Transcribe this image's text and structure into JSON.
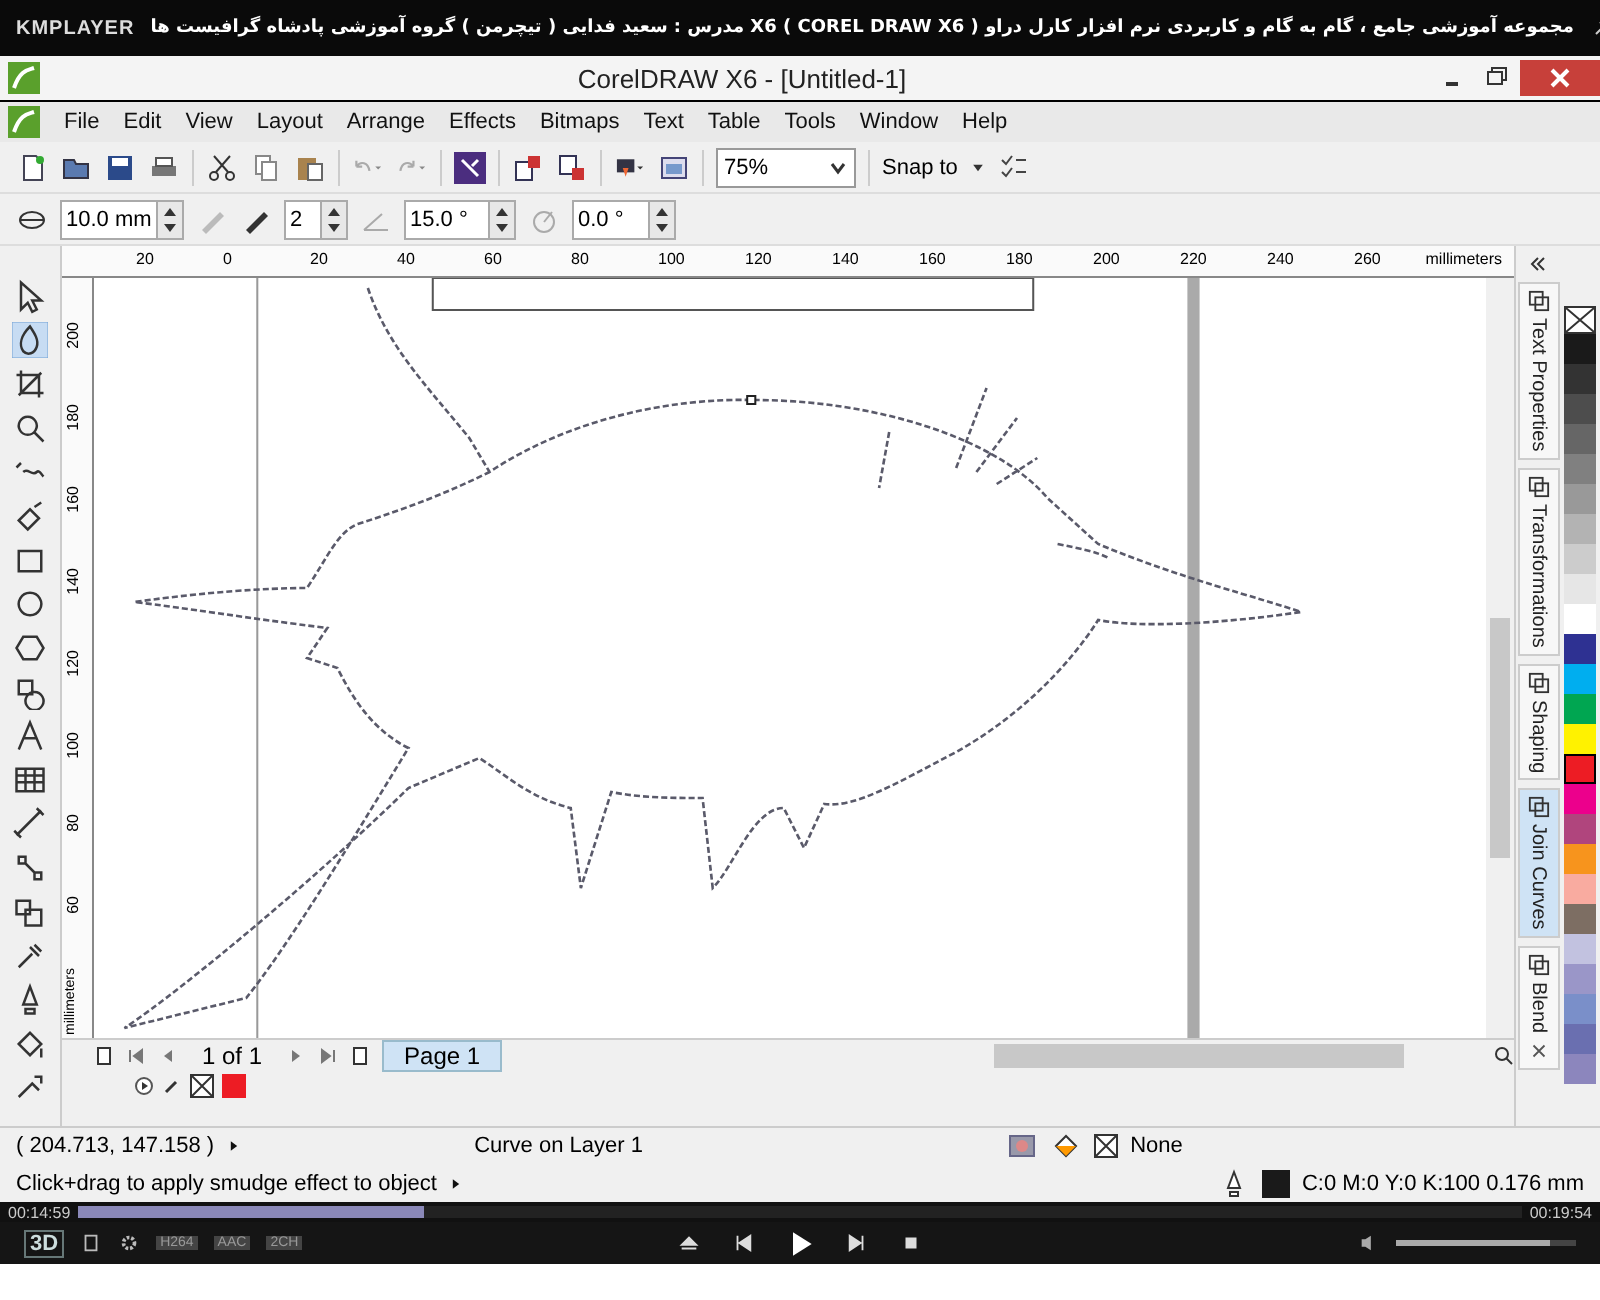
{
  "player": {
    "logo": "KMPLAYER",
    "title": "مجموعه آموزشی جامع ، گام به گام و کاربردی نرم افزار کارل دراو X6 ( COREL DRAW X6 )   مدرس : سعید فدایی ( تیچرمن ) گروه آموزشی پادشاه گرافیست ها",
    "elapsed": "00:14:59",
    "total": "00:19:54",
    "level": 0.24,
    "badges": [
      "3D",
      "H264",
      "AAC",
      "2CH"
    ],
    "volume": {
      "level": 0.86
    }
  },
  "window": {
    "title": "CorelDRAW X6 - [Untitled-1]"
  },
  "menu": [
    "File",
    "Edit",
    "View",
    "Layout",
    "Arrange",
    "Effects",
    "Bitmaps",
    "Text",
    "Table",
    "Tools",
    "Window",
    "Help"
  ],
  "toolbar": {
    "zoom": "75%",
    "snap": "Snap to"
  },
  "property_bar": {
    "fields": [
      "10.0 mm",
      "2",
      "15.0 °",
      "0.0 °"
    ]
  },
  "rulers": {
    "horizontal": [
      "20",
      "0",
      "20",
      "40",
      "60",
      "80",
      "100",
      "120",
      "140",
      "160",
      "180",
      "200",
      "220",
      "240",
      "260"
    ],
    "horizontal_unit": "millimeters",
    "vertical": [
      "200",
      "180",
      "160",
      "140",
      "120",
      "100",
      "80",
      "60"
    ],
    "vertical_unit": "millimeters"
  },
  "tools": [
    {
      "kind": "pick",
      "selected": false
    },
    {
      "kind": "smudge",
      "selected": true
    },
    {
      "kind": "crop",
      "selected": false
    },
    {
      "kind": "zoom",
      "selected": false
    },
    {
      "kind": "freehand",
      "selected": false
    },
    {
      "kind": "smartfill",
      "selected": false
    },
    {
      "kind": "rectangle",
      "selected": false
    },
    {
      "kind": "ellipse",
      "selected": false
    },
    {
      "kind": "polygon",
      "selected": false
    },
    {
      "kind": "shapes",
      "selected": false
    },
    {
      "kind": "text",
      "selected": false
    },
    {
      "kind": "table",
      "selected": false
    },
    {
      "kind": "dimension",
      "selected": false
    },
    {
      "kind": "connector",
      "selected": false
    },
    {
      "kind": "effects",
      "selected": false
    },
    {
      "kind": "eyedropper",
      "selected": false
    },
    {
      "kind": "outline",
      "selected": false
    },
    {
      "kind": "fill",
      "selected": false
    },
    {
      "kind": "interactive",
      "selected": false
    }
  ],
  "dockers": [
    {
      "label": "Text Properties",
      "selected": false,
      "closable": false
    },
    {
      "label": "Transformations",
      "selected": false,
      "closable": false
    },
    {
      "label": "Shaping",
      "selected": false,
      "closable": false
    },
    {
      "label": "Join Curves",
      "selected": true,
      "closable": false
    },
    {
      "label": "Blend",
      "selected": false,
      "closable": true
    }
  ],
  "palette": [
    {
      "color": "#1a1a1a",
      "selected": false
    },
    {
      "color": "#333333",
      "selected": false
    },
    {
      "color": "#4d4d4d",
      "selected": false
    },
    {
      "color": "#666666",
      "selected": false
    },
    {
      "color": "#808080",
      "selected": false
    },
    {
      "color": "#999999",
      "selected": false
    },
    {
      "color": "#b3b3b3",
      "selected": false
    },
    {
      "color": "#cccccc",
      "selected": false
    },
    {
      "color": "#e6e6e6",
      "selected": false
    },
    {
      "color": "#ffffff",
      "selected": false
    },
    {
      "color": "#2e3192",
      "selected": false
    },
    {
      "color": "#00aeef",
      "selected": false
    },
    {
      "color": "#00a651",
      "selected": false
    },
    {
      "color": "#fff200",
      "selected": false
    },
    {
      "color": "#ed1c24",
      "selected": true
    },
    {
      "color": "#ec008c",
      "selected": false
    },
    {
      "color": "#b0457d",
      "selected": false
    },
    {
      "color": "#f7941d",
      "selected": false
    },
    {
      "color": "#f9aba0",
      "selected": false
    },
    {
      "color": "#7d6e63",
      "selected": false
    },
    {
      "color": "#c2c2e0",
      "selected": false
    },
    {
      "color": "#9a96c8",
      "selected": false
    },
    {
      "color": "#7a8fc9",
      "selected": false
    },
    {
      "color": "#6a6fb0",
      "selected": false
    },
    {
      "color": "#8c86bd",
      "selected": false
    }
  ],
  "page_nav": {
    "count": "1 of 1",
    "tab": "Page 1"
  },
  "document_palette": [
    {
      "color": "#ed1c24"
    }
  ],
  "status": {
    "coords": "( 204.713, 147.158 )",
    "object": "Curve on Layer 1",
    "hint": "Click+drag to apply smudge effect to object",
    "fill": "None",
    "outline": "C:0 M:0 Y:0 K:100  0.176 mm"
  }
}
